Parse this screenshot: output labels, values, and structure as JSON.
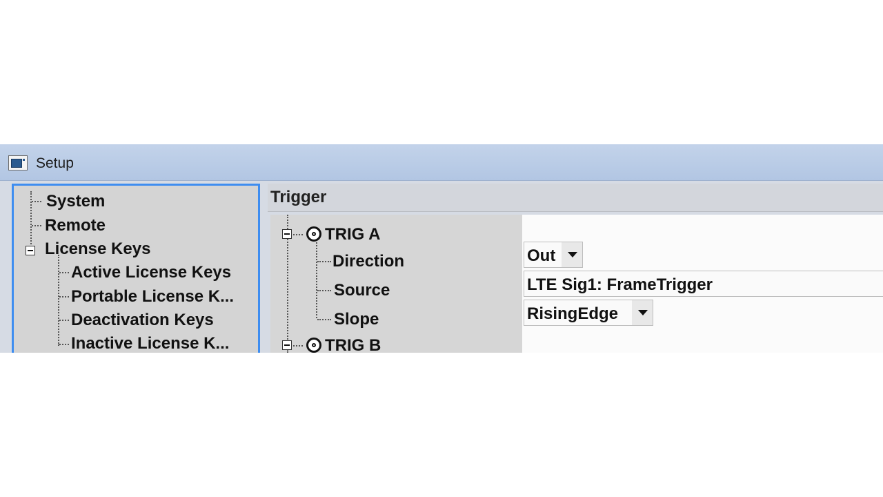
{
  "window": {
    "title": "Setup"
  },
  "tree": {
    "items": [
      {
        "label": "System"
      },
      {
        "label": "Remote"
      },
      {
        "label": "License Keys"
      },
      {
        "label": "Active License Keys"
      },
      {
        "label": "Portable License K..."
      },
      {
        "label": "Deactivation Keys"
      },
      {
        "label": "Inactive License K..."
      }
    ]
  },
  "panel": {
    "header": "Trigger",
    "nodes": [
      {
        "label": "TRIG A",
        "properties": [
          {
            "name": "Direction",
            "value": "Out"
          },
          {
            "name": "Source",
            "value": "LTE Sig1: FrameTrigger"
          },
          {
            "name": "Slope",
            "value": "RisingEdge"
          }
        ]
      },
      {
        "label": "TRIG B"
      }
    ]
  },
  "icons": {
    "app": "setup-window-icon",
    "node": "trigger-node-icon",
    "collapse": "collapse-icon",
    "dropdown": "dropdown-arrow-icon"
  },
  "colors": {
    "selection_border": "#3e8df0",
    "titlebar": "#b8cae5"
  }
}
